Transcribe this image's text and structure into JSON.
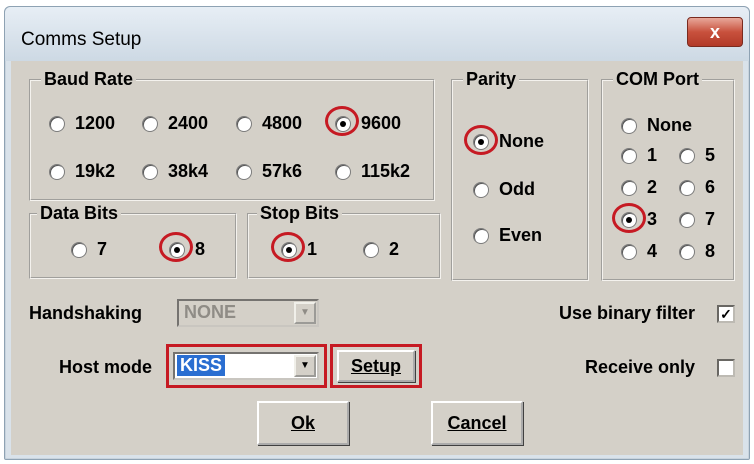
{
  "window": {
    "title": "Comms Setup",
    "close_label": "x"
  },
  "baud_rate": {
    "legend": "Baud Rate",
    "options": [
      "1200",
      "2400",
      "4800",
      "9600",
      "19k2",
      "38k4",
      "57k6",
      "115k2"
    ],
    "selected": "9600"
  },
  "parity": {
    "legend": "Parity",
    "options": [
      "None",
      "Odd",
      "Even"
    ],
    "selected": "None"
  },
  "com_port": {
    "legend": "COM Port",
    "options": [
      "None",
      "1",
      "5",
      "2",
      "6",
      "3",
      "7",
      "4",
      "8"
    ],
    "selected": "3"
  },
  "data_bits": {
    "legend": "Data Bits",
    "options": [
      "7",
      "8"
    ],
    "selected": "8"
  },
  "stop_bits": {
    "legend": "Stop Bits",
    "options": [
      "1",
      "2"
    ],
    "selected": "1"
  },
  "handshaking": {
    "label": "Handshaking",
    "value": "NONE",
    "enabled": false
  },
  "host_mode": {
    "label": "Host mode",
    "value": "KISS"
  },
  "buttons": {
    "setup": "Setup",
    "ok": "Ok",
    "cancel": "Cancel"
  },
  "checkboxes": {
    "binary_filter": {
      "label": "Use binary filter",
      "checked": true,
      "mark": "✓"
    },
    "receive_only": {
      "label": "Receive only",
      "checked": false
    }
  },
  "colors": {
    "highlight": "#c61a23",
    "selection": "#2a6ed1",
    "dialog_bg": "#d4d0c8"
  }
}
